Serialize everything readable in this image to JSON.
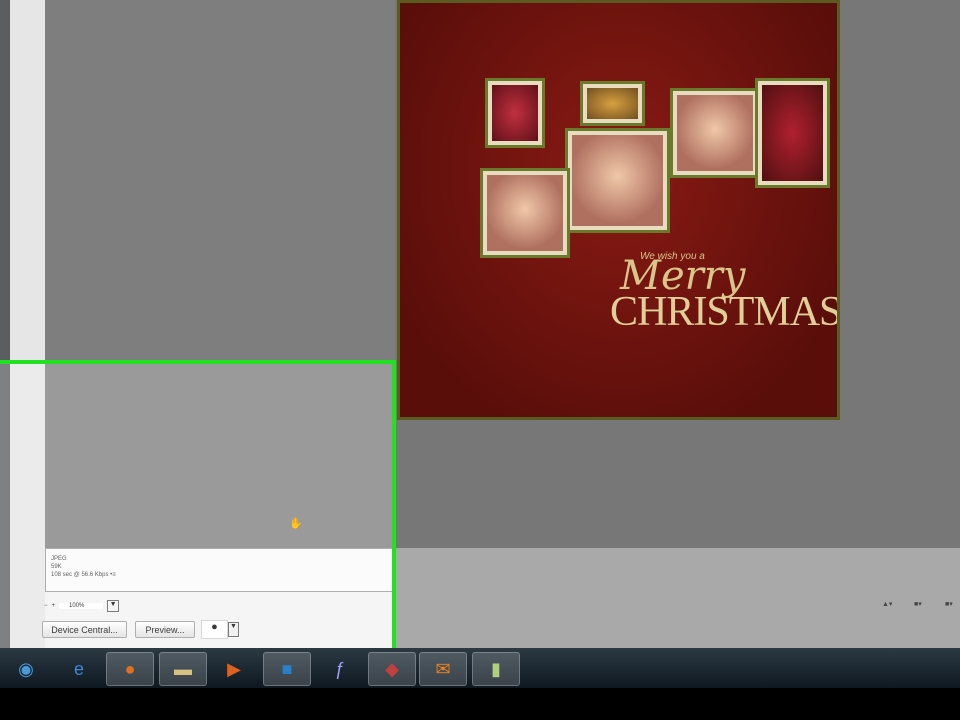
{
  "artwork": {
    "wish": "We wish you a",
    "merry": "Merry",
    "christmas": "CHRISTMAS"
  },
  "info": {
    "format": "JPEG",
    "size": "59K",
    "speed": "108 sec @ 56.6 Kbps",
    "extra": "•≡"
  },
  "zoom": {
    "value": "100%"
  },
  "buttons": {
    "device_central": "Device Central...",
    "preview": "Preview..."
  },
  "taskbar": {
    "items": [
      "start",
      "internet-explorer",
      "firefox",
      "file-explorer",
      "media-player",
      "photoshop",
      "flash",
      "paint",
      "mail",
      "misc"
    ]
  },
  "colors": {
    "highlight": "#22e022"
  }
}
